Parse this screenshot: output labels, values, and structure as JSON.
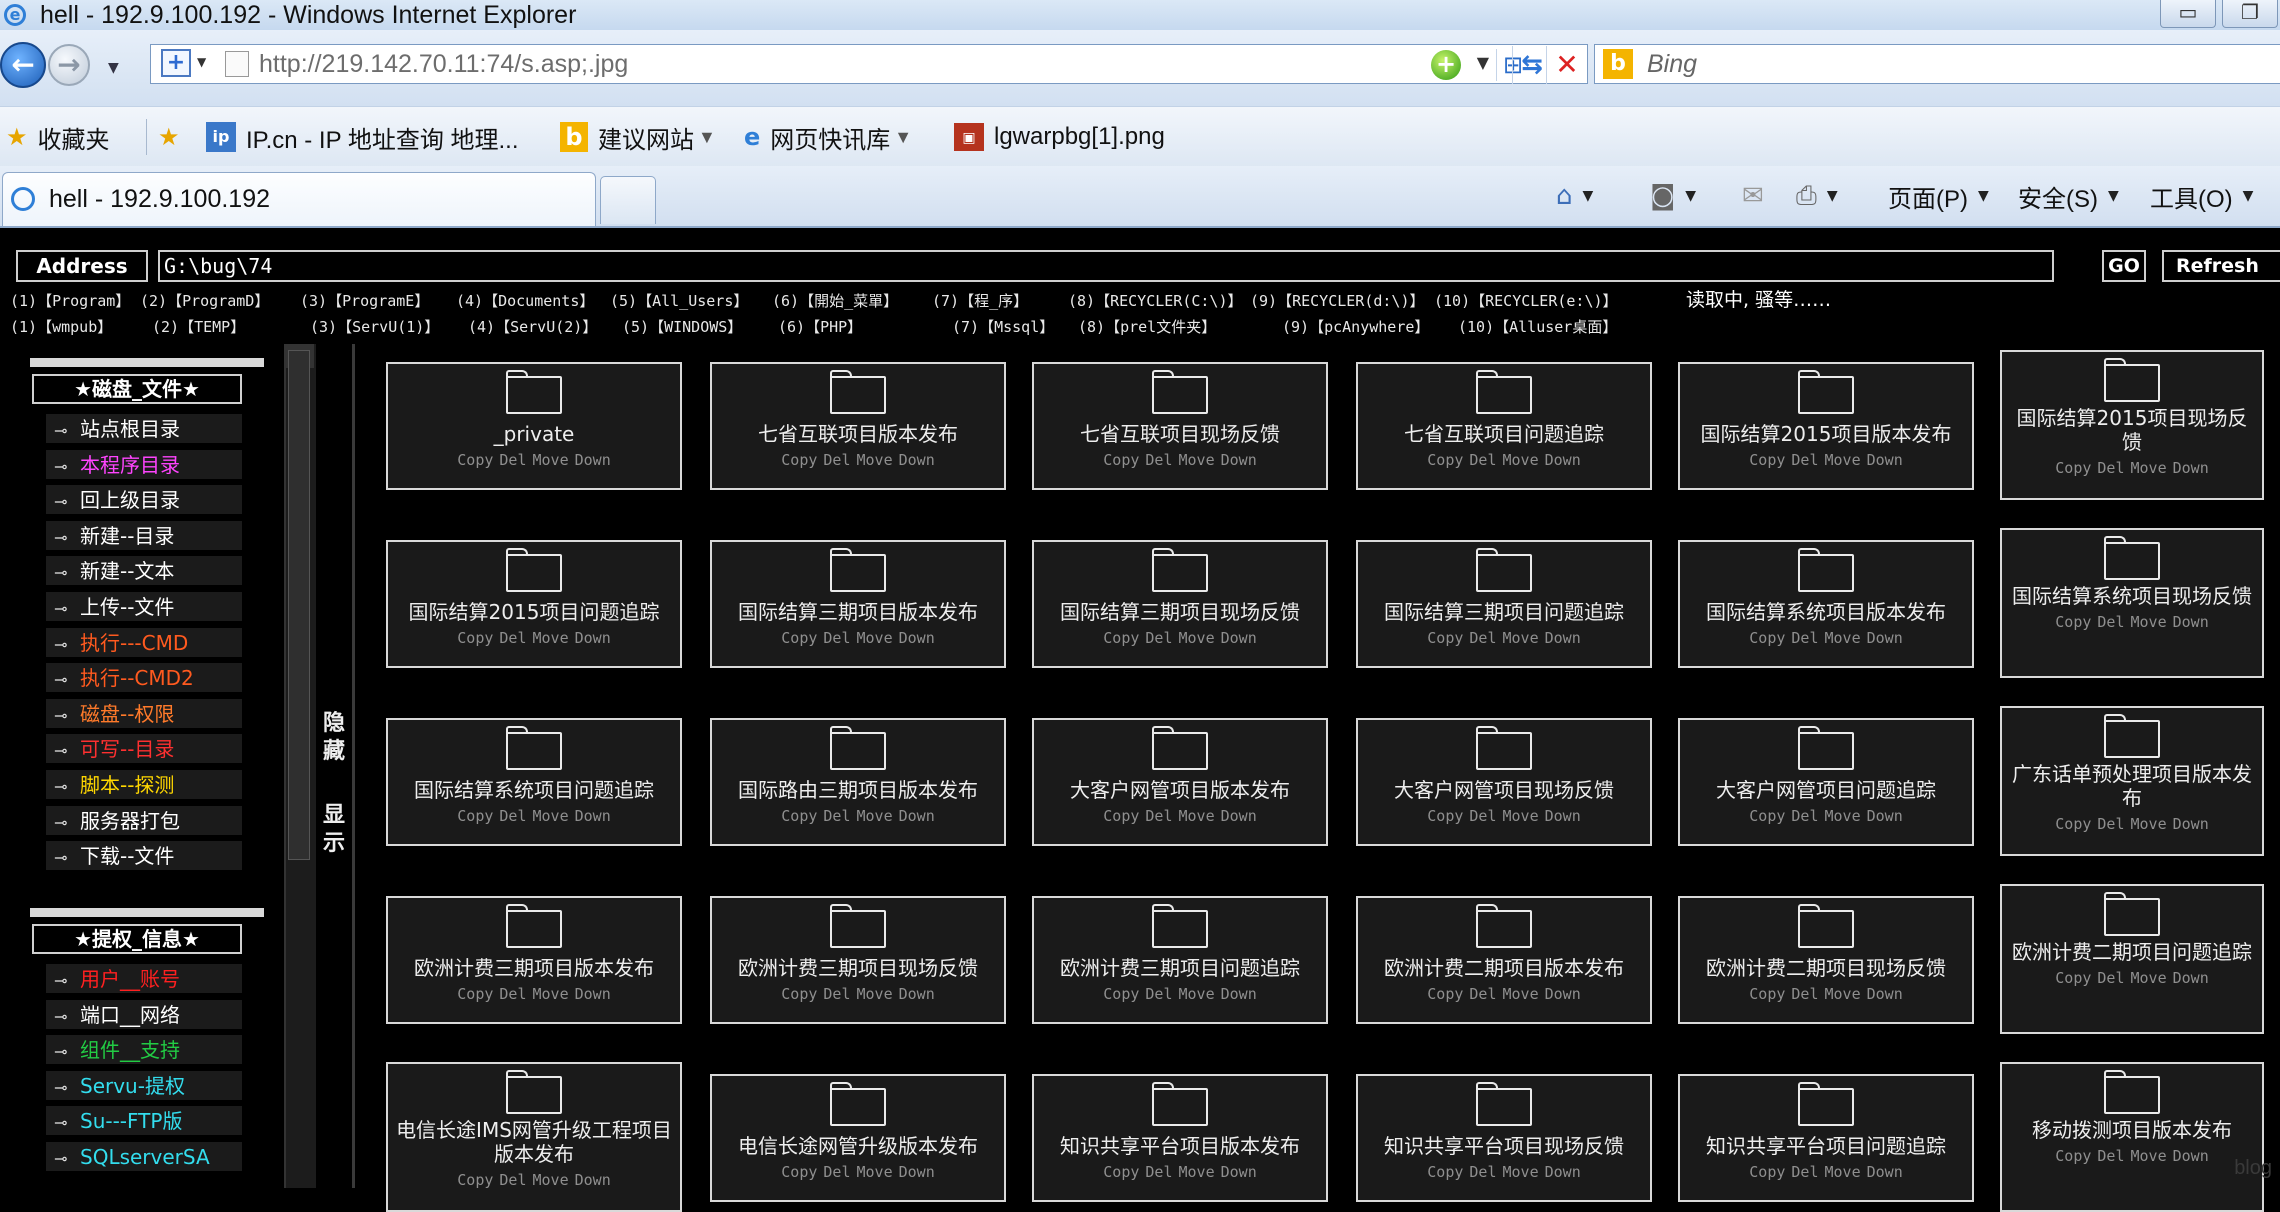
{
  "window": {
    "title": "hell - 192.9.100.192 - Windows Internet Explorer",
    "minimize": "▭",
    "restore": "❐"
  },
  "nav": {
    "url": "http://219.142.70.11:74/s.asp;.jpg",
    "search_placeholder": "Bing"
  },
  "favorites": {
    "label": "收藏夹",
    "items": [
      {
        "label": "IP.cn - IP 地址查询  地理...",
        "icon": "ip-site-icon"
      },
      {
        "label": "建议网站",
        "icon": "bing-icon"
      },
      {
        "label": "网页快讯库",
        "icon": "ie-icon"
      },
      {
        "label": "lgwarpbg[1].png",
        "icon": "image-icon"
      }
    ]
  },
  "tabs": {
    "active_title": "hell - 192.9.100.192"
  },
  "commands": {
    "page": "页面(P)",
    "safety": "安全(S)",
    "tools": "工具(O)"
  },
  "shell": {
    "address_label": "Address",
    "address_value": "G:\\bug\\74",
    "go_label": "GO",
    "refresh_label": "Refresh",
    "status_text": "读取中, 骚等……",
    "quick_row1": [
      "(1)【Program】",
      "(2)【ProgramD】",
      "(3)【ProgramE】",
      "(4)【Documents】",
      "(5)【All_Users】",
      "(6)【開始_菜單】",
      "(7)【程_序】",
      "(8)【RECYCLER(C:\\)】",
      "(9)【RECYCLER(d:\\)】",
      "(10)【RECYCLER(e:\\)】"
    ],
    "quick_row2": [
      "(1)【wmpub】",
      "(2)【TEMP】",
      "(3)【ServU(1)】",
      "(4)【ServU(2)】",
      "(5)【WINDOWS】",
      "(6)【PHP】",
      "(7)【Mssql】",
      "(8)【prel文件夹】",
      "(9)【pcAnywhere】",
      "(10)【Alluser桌面】"
    ],
    "toggle_hide": "隐藏",
    "toggle_show": "显示"
  },
  "sidebar": {
    "section1_title": "★磁盘_文件★",
    "section1_items": [
      {
        "label": "站点根目录",
        "color": "#ffffff"
      },
      {
        "label": "本程序目录",
        "color": "#ff44ff"
      },
      {
        "label": "回上级目录",
        "color": "#ffffff"
      },
      {
        "label": "新建--目录",
        "color": "#ffffff"
      },
      {
        "label": "新建--文本",
        "color": "#ffffff"
      },
      {
        "label": "上传--文件",
        "color": "#ffffff"
      },
      {
        "label": "执行---CMD",
        "color": "#ff5a1f"
      },
      {
        "label": "执行--CMD2",
        "color": "#ff5a1f"
      },
      {
        "label": "磁盘--权限",
        "color": "#ff7a2a"
      },
      {
        "label": "可写--目录",
        "color": "#ff3030"
      },
      {
        "label": "脚本--探测",
        "color": "#ffd700"
      },
      {
        "label": "服务器打包",
        "color": "#ffffff"
      },
      {
        "label": "下载--文件",
        "color": "#ffffff"
      }
    ],
    "section2_title": "★提权_信息★",
    "section2_items": [
      {
        "label": "用户__账号",
        "color": "#ff2020"
      },
      {
        "label": "端口__网络",
        "color": "#ffffff"
      },
      {
        "label": "组件__支持",
        "color": "#22cc44"
      },
      {
        "label": "Servu-提权",
        "color": "#33ddee"
      },
      {
        "label": "Su---FTP版",
        "color": "#33ddee"
      },
      {
        "label": "SQLserverSA",
        "color": "#33ddee"
      }
    ]
  },
  "card_actions": [
    "Copy",
    "Del",
    "Move",
    "Down"
  ],
  "folders": [
    "_private",
    "七省互联项目版本发布",
    "七省互联项目现场反馈",
    "七省互联项目问题追踪",
    "国际结算2015项目版本发布",
    "国际结算2015项目现场反馈",
    "国际结算2015项目问题追踪",
    "国际结算三期项目版本发布",
    "国际结算三期项目现场反馈",
    "国际结算三期项目问题追踪",
    "国际结算系统项目版本发布",
    "国际结算系统项目现场反馈",
    "国际结算系统项目问题追踪",
    "国际路由三期项目版本发布",
    "大客户网管项目版本发布",
    "大客户网管项目现场反馈",
    "大客户网管项目问题追踪",
    "广东话单预处理项目版本发布",
    "欧洲计费三期项目版本发布",
    "欧洲计费三期项目现场反馈",
    "欧洲计费三期项目问题追踪",
    "欧洲计费二期项目版本发布",
    "欧洲计费二期项目现场反馈",
    "欧洲计费二期项目问题追踪",
    "电信长途IMS网管升级工程项目版本发布",
    "电信长途网管升级版本发布",
    "知识共享平台项目版本发布",
    "知识共享平台项目现场反馈",
    "知识共享平台项目问题追踪",
    "移动拨测项目版本发布"
  ],
  "watermark": "blog"
}
